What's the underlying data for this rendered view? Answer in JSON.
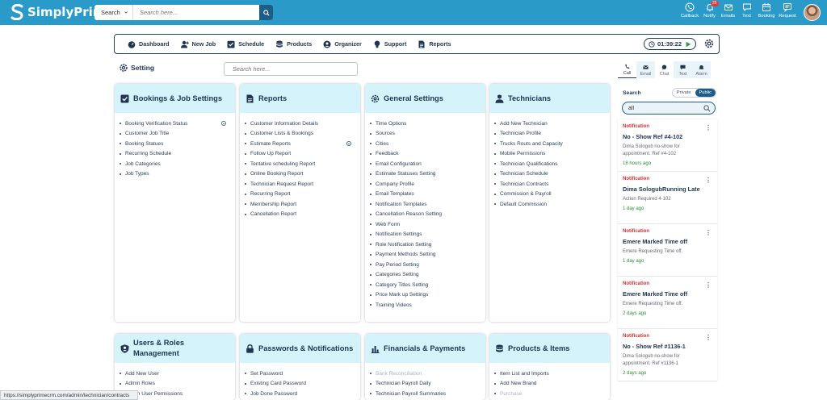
{
  "app": {
    "brand": "SimplyPrime"
  },
  "search": {
    "scope": "Search",
    "placeholder": "Search here..."
  },
  "top_actions": [
    {
      "icon": "phone-icon",
      "label": "Callback"
    },
    {
      "icon": "bell-icon",
      "label": "Notify",
      "badge": "25"
    },
    {
      "icon": "mail-icon",
      "label": "Emails"
    },
    {
      "icon": "chat-icon",
      "label": "Text"
    },
    {
      "icon": "calendar-icon",
      "label": "Booking"
    },
    {
      "icon": "request-icon",
      "label": "Request"
    }
  ],
  "nav": {
    "items": [
      {
        "icon": "dashboard-icon",
        "label": "Dashboard"
      },
      {
        "icon": "user-add-icon",
        "label": "New Job"
      },
      {
        "icon": "check-calendar-icon",
        "label": "Schedule"
      },
      {
        "icon": "database-icon",
        "label": "Products"
      },
      {
        "icon": "organizer-icon",
        "label": "Organizer"
      },
      {
        "icon": "bulb-icon",
        "label": "Support"
      },
      {
        "icon": "report-icon",
        "label": "Reports"
      }
    ],
    "timer": "01:39:22"
  },
  "page": {
    "title": "Setting",
    "search_placeholder": "Search here..."
  },
  "cards": [
    {
      "title": "Bookings & Job Settings",
      "icon": "checkbox-icon",
      "items": [
        "Booking Verification Status",
        "Customer Job Title",
        "Booking Statues",
        "Recurring Schedule",
        "Job Categories",
        "Job Types"
      ]
    },
    {
      "title": "Reports",
      "icon": "report-icon",
      "items": [
        "Customer Information Details",
        "Customer Lists & Bookings",
        "Estimate Reports",
        "Follow Up Report",
        "Tentative scheduling Report",
        "Online Booking Report",
        "Technician Request Report",
        "Recurring Report",
        "Membership Report",
        "Cancellation Report"
      ]
    },
    {
      "title": "General Settings",
      "icon": "gear-icon",
      "items": [
        "Time Options",
        "Sources",
        "Cities",
        "Feedback",
        "Email Configuration",
        "Estimate Statuses Setting",
        "Company Profile",
        "Email Templates",
        "Notification Templates",
        "Cancellation Reason Setting",
        "Web Form",
        "Notification Settings",
        "Role Notification Setting",
        "Payment Methods Setting",
        "Pay Period Setting",
        "Categories Setting",
        "Category Titles Setting",
        "Price Mark up Settings",
        "Training Videos"
      ]
    },
    {
      "title": "Technicians",
      "icon": "technician-icon",
      "items": [
        "Add New Technician",
        "Technician Profile",
        "Trucks Routs and Capacity",
        "Mobile Permissions",
        "Technician Qualifications",
        "Technician Schedule",
        "Technician Contracts",
        "Commission & Payroll",
        "Default Commission"
      ]
    },
    {
      "title": "Users & Roles Management",
      "icon": "shield-user-icon",
      "items": [
        "Add New User",
        "Admin Roles",
        "Admin User Permissions"
      ]
    },
    {
      "title": "Passwords & Notifications",
      "icon": "lock-icon",
      "items": [
        "Set Password",
        "Existing Card Password",
        "Job Done Password"
      ]
    },
    {
      "title": "Financials & Payments",
      "icon": "bar-chart-icon",
      "items": [
        "Bank Reconciliation",
        "Technician Payroll Daily",
        "Technician Payroll Summaries"
      ]
    },
    {
      "title": "Products & Items",
      "icon": "database-icon",
      "items": [
        "Item List and Imports",
        "Add New Brand",
        "Purchase"
      ]
    }
  ],
  "right_panel": {
    "tabs": [
      "Call",
      "Email",
      "Chat",
      "Text",
      "Alarm"
    ],
    "search_label": "Search",
    "toggle": [
      "Private",
      "Public"
    ],
    "search_value": "all",
    "notifications": [
      {
        "type": "Notification",
        "title": "No - Show Ref #4-102",
        "desc": "Dima Sologub no-show for appointment. Ref #4-102",
        "time": "18 hours ago"
      },
      {
        "type": "Notification",
        "title": "Dima SologubRunning Late",
        "desc": "Action Required 4-102",
        "time": "1 day ago"
      },
      {
        "type": "Notification",
        "title": "Emere Marked Time off",
        "desc": "Emere Requesting Time off.",
        "time": "1 day ago"
      },
      {
        "type": "Notification",
        "title": "Emere Marked Time off",
        "desc": "Emere Requesting Time off.",
        "time": "2 days ago"
      },
      {
        "type": "Notification",
        "title": "No - Show Ref #1136-1",
        "desc": "Dima Sologub no-show for appointment. Ref #1136-1",
        "time": "2 days ago"
      }
    ]
  },
  "status_url": "https://simplyprimecrm.com/admin/technician/contracts"
}
